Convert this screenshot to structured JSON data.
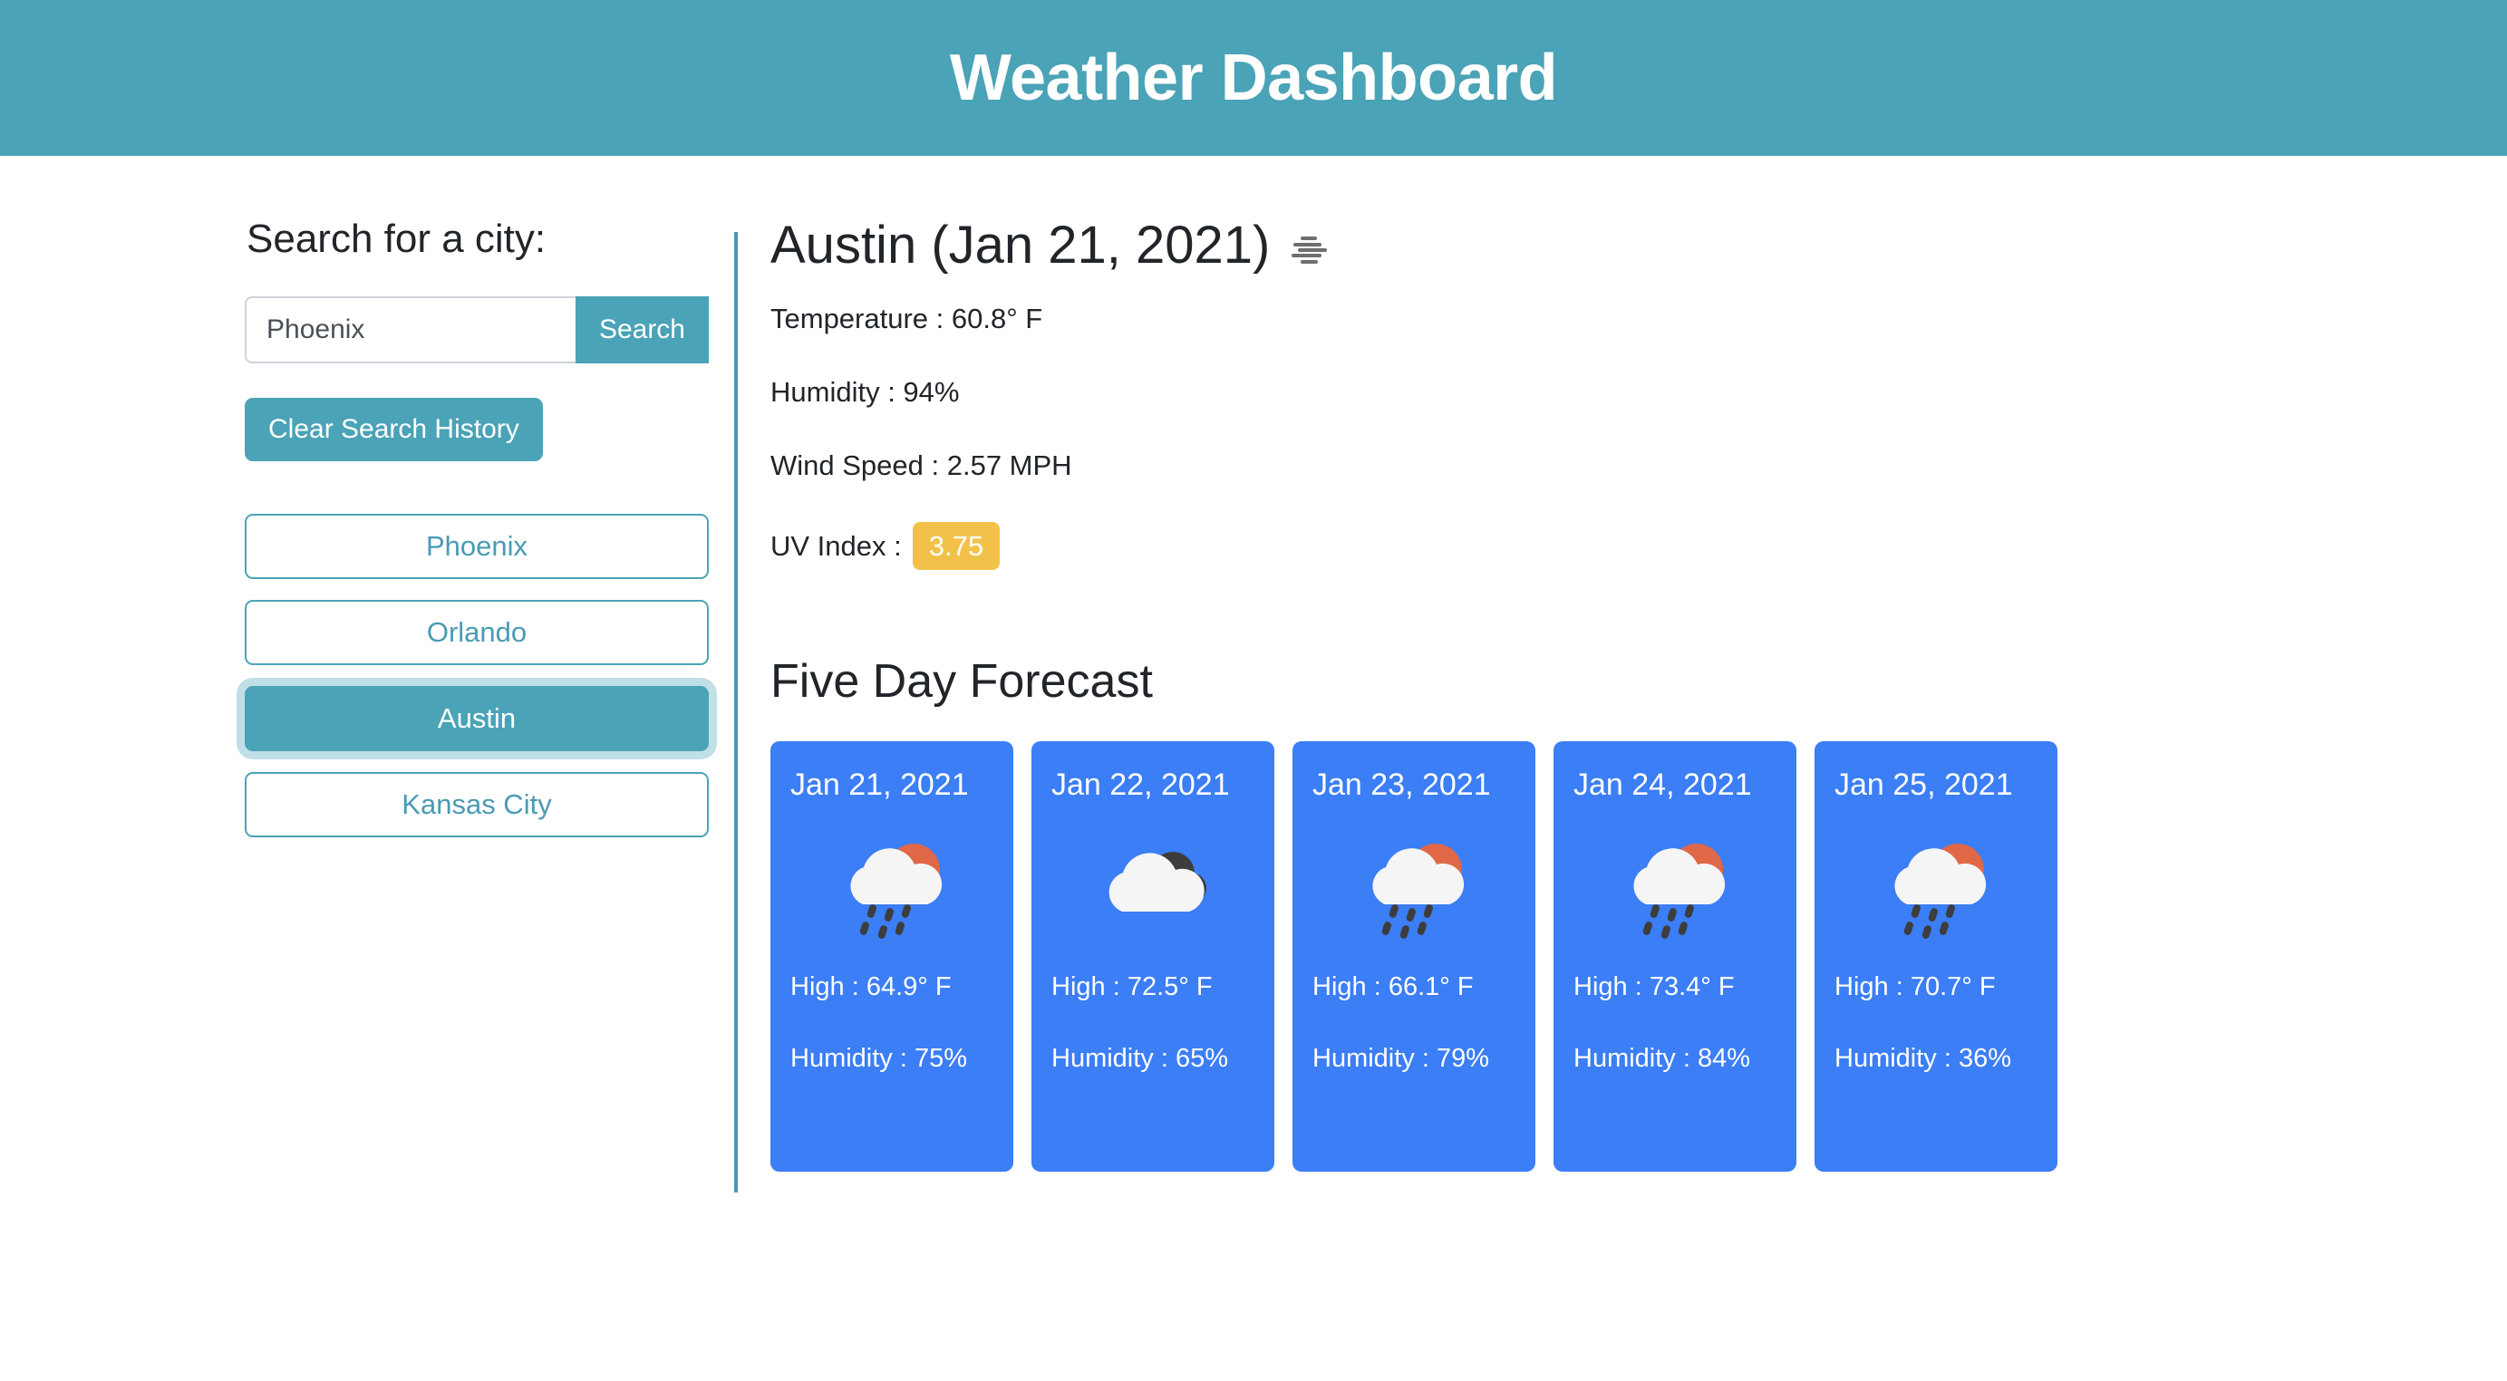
{
  "header": {
    "title": "Weather Dashboard",
    "bg_color": "#4aa3b6"
  },
  "sidebar": {
    "heading": "Search for a city:",
    "search": {
      "value": "Phoenix",
      "placeholder": "Phoenix",
      "button_label": "Search"
    },
    "clear_button_label": "Clear Search History",
    "history": [
      {
        "label": "Phoenix",
        "active": false
      },
      {
        "label": "Orlando",
        "active": false
      },
      {
        "label": "Austin",
        "active": true
      },
      {
        "label": "Kansas City",
        "active": false
      }
    ]
  },
  "current": {
    "title": "Austin (Jan 21, 2021)",
    "icon": "mist-icon",
    "temperature": "Temperature : 60.8° F",
    "humidity": "Humidity : 94%",
    "wind_speed": "Wind Speed : 2.57 MPH",
    "uv_label": "UV Index :",
    "uv_value": "3.75",
    "uv_badge_color": "#f2c14a"
  },
  "forecast": {
    "title": "Five Day Forecast",
    "card_color": "#3b7ef5",
    "days": [
      {
        "date": "Jan 21, 2021",
        "icon": "sun-cloud-rain-icon",
        "high": "High : 64.9° F",
        "humidity": "Humidity : 75%"
      },
      {
        "date": "Jan 22, 2021",
        "icon": "broken-clouds-icon",
        "high": "High : 72.5° F",
        "humidity": "Humidity : 65%"
      },
      {
        "date": "Jan 23, 2021",
        "icon": "sun-cloud-rain-icon",
        "high": "High : 66.1° F",
        "humidity": "Humidity : 79%"
      },
      {
        "date": "Jan 24, 2021",
        "icon": "sun-cloud-rain-icon",
        "high": "High : 73.4° F",
        "humidity": "Humidity : 84%"
      },
      {
        "date": "Jan 25, 2021",
        "icon": "sun-cloud-rain-icon",
        "high": "High : 70.7° F",
        "humidity": "Humidity : 36%"
      }
    ]
  }
}
